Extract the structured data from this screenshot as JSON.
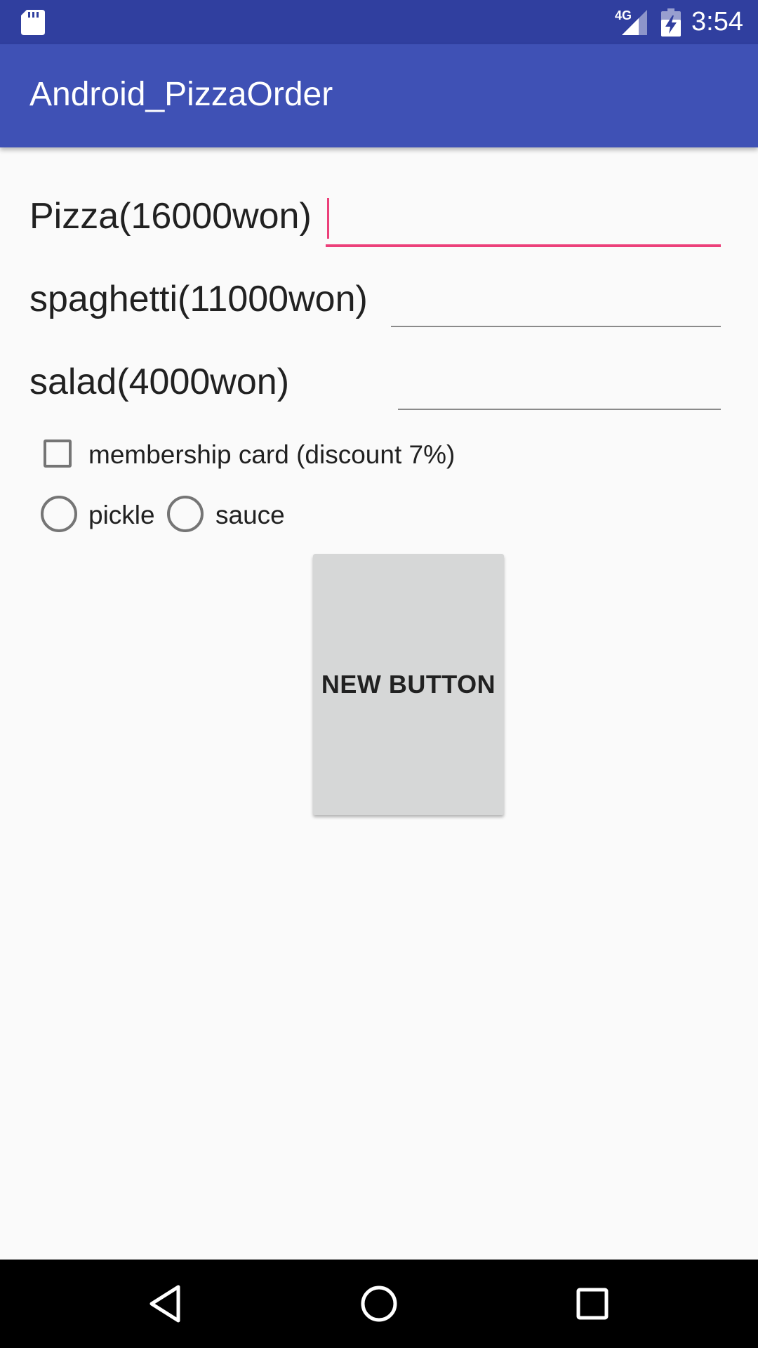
{
  "status_bar": {
    "time": "3:54",
    "network_type": "4G",
    "icons": [
      "sd-card-icon",
      "signal-icon",
      "battery-charging-icon"
    ]
  },
  "app_bar": {
    "title": "Android_PizzaOrder"
  },
  "form": {
    "pizza_label": "Pizza(16000won)",
    "pizza_value": "",
    "spaghetti_label": "spaghetti(11000won)",
    "spaghetti_value": "",
    "salad_label": "salad(4000won)",
    "salad_value": "",
    "membership_label": "membership card (discount 7%)",
    "membership_checked": false,
    "radio_options": [
      "pickle",
      "sauce"
    ],
    "button_label": "NEW BUTTON"
  },
  "colors": {
    "status_bar": "#303f9f",
    "app_bar": "#3f51b5",
    "accent": "#ec407a",
    "background": "#fafafa",
    "button": "#d6d7d7"
  },
  "nav_bar": {
    "icons": [
      "back-icon",
      "home-icon",
      "recents-icon"
    ]
  }
}
